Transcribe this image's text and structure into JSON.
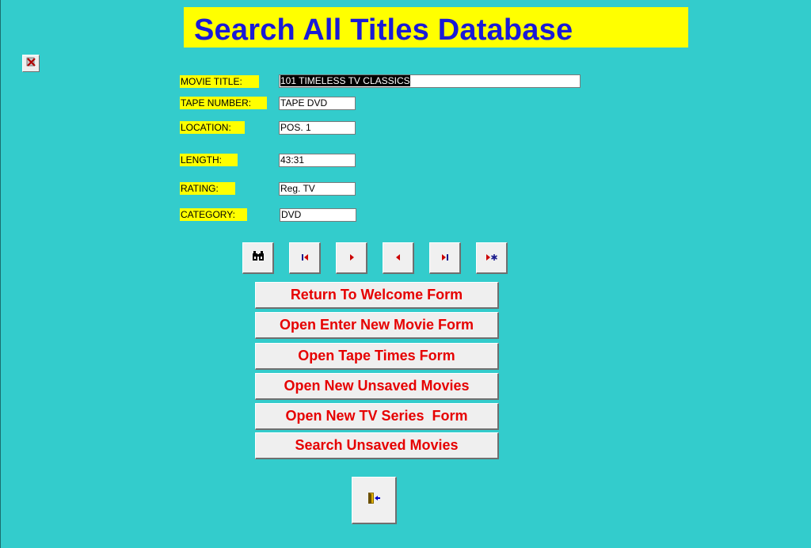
{
  "header": {
    "title": "Search All Titles Database"
  },
  "close_icon": "close-form-icon",
  "fields": {
    "movie_title": {
      "label": "MOVIE TITLE:",
      "value": "101 TIMELESS TV CLASSICS"
    },
    "tape_number": {
      "label": "TAPE NUMBER:",
      "value": "TAPE DVD"
    },
    "location": {
      "label": "LOCATION:",
      "value": "POS. 1"
    },
    "length": {
      "label": "LENGTH:",
      "value": "43:31"
    },
    "rating": {
      "label": "RATING:",
      "value": "Reg. TV"
    },
    "category": {
      "label": "CATEGORY:",
      "value": "DVD"
    }
  },
  "nav_icons": [
    "binoculars-icon",
    "first-record-icon",
    "next-record-icon",
    "previous-record-icon",
    "last-record-icon",
    "new-record-icon"
  ],
  "buttons": {
    "return_welcome": "Return To Welcome Form",
    "enter_new_movie": "Open Enter New Movie Form",
    "tape_times": "Open Tape Times Form",
    "new_unsaved": "Open New Unsaved Movies",
    "tv_series": "Open New TV Series  Form",
    "search_unsaved": "Search Unsaved Movies"
  },
  "exit_icon": "exit-door-icon",
  "colors": {
    "background": "#33cccc",
    "title_bg": "#ffff00",
    "title_text": "#1a1ad6",
    "label_bg": "#ffff00",
    "button_text": "#e60000"
  }
}
